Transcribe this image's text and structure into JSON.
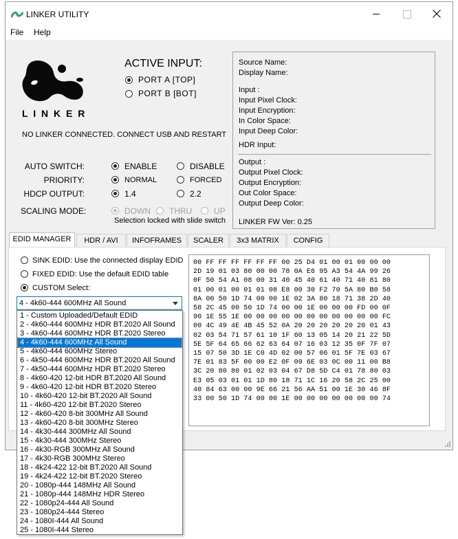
{
  "window": {
    "title": "LINKER UTILITY",
    "menu": [
      "File",
      "Help"
    ]
  },
  "logo": {
    "text": "L I N K E R"
  },
  "active_input": {
    "title": "ACTIVE INPUT:",
    "options": [
      "PORT A [TOP]",
      "PORT B [BOT]"
    ],
    "selected": 0
  },
  "status_message": "NO LINKER CONNECTED. CONNECT USB AND RESTART",
  "settings": {
    "auto_switch": {
      "label": "AUTO SWITCH:",
      "options": [
        "ENABLE",
        "DISABLE"
      ],
      "selected": 0
    },
    "priority": {
      "label": "PRIORITY:",
      "options": [
        "NORMAL",
        "FORCED"
      ],
      "selected": 0
    },
    "hdcp_output": {
      "label": "HDCP OUTPUT:",
      "options": [
        "1.4",
        "2.2"
      ],
      "selected": 0
    },
    "scaling_mode": {
      "label": "SCALING MODE:",
      "options": [
        "DOWN",
        "THRU",
        "UP"
      ],
      "selected": 0,
      "note": "Selection locked with slide switch"
    }
  },
  "info_panel": {
    "source_name": "Source Name:",
    "display_name": "Display Name:",
    "input": "Input :",
    "input_pixel_clock": "Input Pixel Clock:",
    "input_encryption": "Input Encryption:",
    "in_color_space": "In Color Space:",
    "input_deep_color": "Input Deep Color:",
    "hdr_input": "HDR Input:",
    "output": "Output :",
    "output_pixel_clock": "Output Pixel Clock:",
    "output_encryption": "Output Encryption:",
    "out_color_space": "Out Color Space:",
    "output_deep_color": "Output Deep Color:",
    "fw_version": "LINKER FW Ver: 0.25"
  },
  "tabs": [
    "EDID MANAGER",
    "HDR / AVI",
    "INFOFRAMES",
    "SCALER",
    "3x3 MATRIX",
    "CONFIG"
  ],
  "active_tab": 0,
  "edid": {
    "sink_option": "SINK EDID: Use the connected display EDID",
    "fixed_option": "FIXED EDID: Use the default EDID table",
    "custom_option": "CUSTOM Select:",
    "selected_option": 2,
    "combo_value": "4 - 4k60-444 600MHz All Sound",
    "dropdown_items": [
      "1 - Custom Uploaded/Default EDID",
      "2 - 4k60-444 600MHz HDR BT.2020 All Sound",
      "3 - 4k60-444 600MHz HDR BT.2020 Stereo",
      "4 - 4k60-444 600MHz All Sound",
      "5 - 4k60-444 600MHz Stereo",
      "6 - 4k50-444 600MHz HDR BT.2020 All Sound",
      "7 - 4k50-444 600MHz HDR BT.2020 Stereo",
      "8 - 4k60-420 12-bit HDR BT.2020 All Sound",
      "9 - 4k60-420 12-bit HDR BT.2020 Stereo",
      "10 - 4k60-420 12-bit BT.2020 All Sound",
      "11 - 4k60-420 12-bit BT.2020 Stereo",
      "12 - 4k60-420 8-bit 300MHz All Sound",
      "13 - 4k60-420 8-bit 300MHz Stereo",
      "14 - 4k30-444 300MHz All Sound",
      "15 - 4k30-444 300MHz Stereo",
      "16 - 4k30-RGB 300MHz All Sound",
      "17 - 4k30-RGB 300MHz Stereo",
      "18 - 4k24-422 12-bit BT.2020 All Sound",
      "19 - 4k24-422 12-bit BT.2020 Stereo",
      "20 - 1080p-444 148MHz All Sound",
      "21 - 1080p-444 148MHz HDR Stereo",
      "22 - 1080p24-444 All Sound",
      "23 - 1080p24-444 Stereo",
      "24 - 1080I-444 All Sound",
      "25 - 1080I-444 Stereo"
    ],
    "dropdown_selected": 3,
    "hex_lines": [
      "00 FF FF FF FF FF FF 00 25 D4 01 00 01 00 00 00",
      "2D 19 01 03 80 00 00 78 0A E6 95 A3 54 4A 99 26",
      "0F 50 54 A1 08 00 31 40 45 40 61 40 71 40 81 80",
      "01 00 01 00 01 01 08 E8 00 30 F2 70 5A 80 B0 58",
      "8A 00 50 1D 74 00 00 1E 02 3A 80 18 71 38 2D 40",
      "58 2C 45 00 50 1D 74 00 00 1E 00 00 00 FD 00 0F",
      "90 1E 55 1E 00 00 00 00 00 00 00 00 00 00 00 FC",
      "00 4C 49 4E 4B 45 52 0A 20 20 20 20 20 20 01 43",
      "02 03 54 71 57 61 10 1F 60 13 05 14 20 21 22 5D",
      "5E 5F 64 65 66 62 63 64 07 16 03 12 35 0F 7F 07",
      "15 07 50 3D 1E C0 4D 02 00 57 06 01 5F 7E 03 67",
      "7E 01 83 5F 00 00 E2 0F 09 6E 03 0C 00 11 00 B8",
      "3C 20 80 80 01 02 03 04 67 D8 5D C4 01 78 80 03",
      "E3 05 03 01 01 1D 80 18 71 1C 16 20 58 2C 25 00",
      "40 84 63 00 00 9E 66 21 56 AA 51 00 1E 30 46 8F",
      "33 00 50 1D 74 00 00 1E 00 00 00 00 00 00 00 74"
    ]
  },
  "colors": {
    "accent": "#0078d7",
    "app_icon": "#2e9e6f"
  }
}
